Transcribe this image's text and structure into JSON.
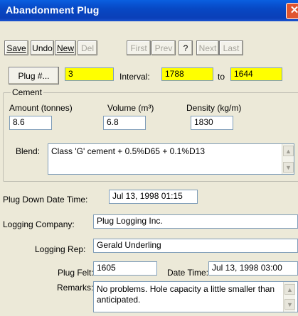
{
  "window": {
    "title": "Abandonment Plug",
    "close_glyph": "✕"
  },
  "toolbar": {
    "save": "Save",
    "undo": "Undo",
    "new": "New",
    "del": "Del",
    "first": "First",
    "prev": "Prev",
    "help": "?",
    "next": "Next",
    "last": "Last"
  },
  "plug": {
    "button": "Plug #...",
    "number": "3",
    "interval_label": "Interval:",
    "interval_from": "1788",
    "to_label": "to",
    "interval_to": "1644"
  },
  "cement": {
    "group_label": "Cement",
    "amount_label": "Amount (tonnes)",
    "amount": "8.6",
    "volume_label": "Volume (m³)",
    "volume": "6.8",
    "density_label": "Density (kg/m)",
    "density": "1830",
    "blend_label": "Blend:",
    "blend": "Class 'G' cement + 0.5%D65 + 0.1%D13"
  },
  "details": {
    "plug_down_label": "Plug Down Date Time:",
    "plug_down": "Jul 13, 1998 01:15",
    "company_label": "Logging Company:",
    "company": "Plug Logging Inc.",
    "rep_label": "Logging Rep:",
    "rep": "Gerald Underling",
    "felt_label": "Plug Felt:",
    "felt": "1605",
    "datetime_label": "Date Time:",
    "datetime": "Jul 13, 1998 03:00",
    "remarks_label": "Remarks:",
    "remarks": "No problems. Hole capacity a little smaller than anticipated."
  }
}
